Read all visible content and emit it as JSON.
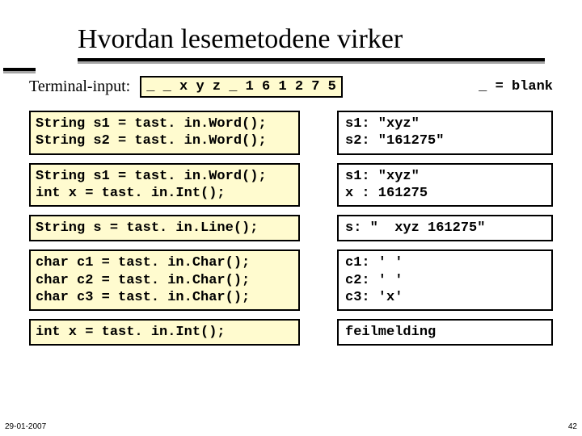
{
  "title": "Hvordan lesemetodene virker",
  "terminal_label": "Terminal-input:",
  "terminal_value": "_ _ x y z _ 1 6 1 2 7 5",
  "legend": "_ = blank",
  "examples": [
    {
      "code": "String s1 = tast. in.Word();\nString s2 = tast. in.Word();",
      "result": "s1: \"xyz\"\ns2: \"161275\""
    },
    {
      "code": "String s1 = tast. in.Word();\nint x = tast. in.Int();",
      "result": "s1: \"xyz\"\nx : 161275"
    },
    {
      "code": "String s = tast. in.Line();",
      "result": "s: \"  xyz 161275\""
    },
    {
      "code": "char c1 = tast. in.Char();\nchar c2 = tast. in.Char();\nchar c3 = tast. in.Char();",
      "result": "c1: ' '\nc2: ' '\nc3: 'x'"
    },
    {
      "code": "int x = tast. in.Int();",
      "result": "feilmelding"
    }
  ],
  "footer": {
    "date": "29-01-2007",
    "page": "42"
  }
}
